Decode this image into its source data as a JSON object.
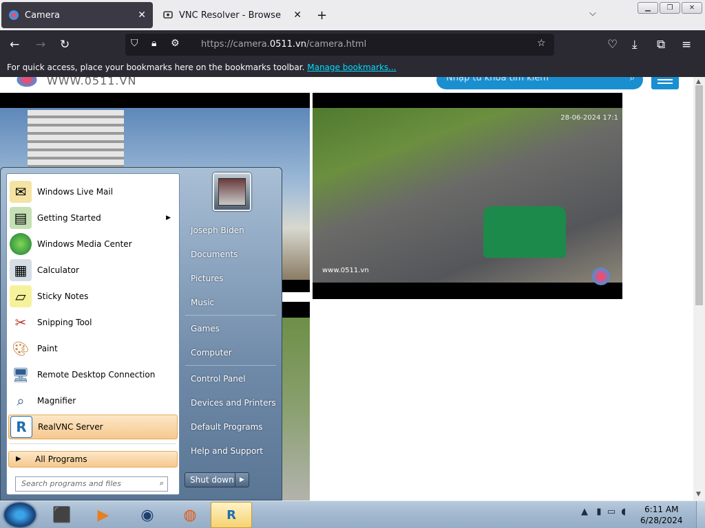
{
  "browser": {
    "tabs": [
      {
        "title": "Camera",
        "active": true
      },
      {
        "title": "VNC Resolver - Browse",
        "active": false
      }
    ],
    "url_prefix": "https://camera.",
    "url_domain": "0511.vn",
    "url_path": "/camera.html",
    "bookmarks_text": "For quick access, place your bookmarks here on the bookmarks toolbar.",
    "bookmarks_link": "Manage bookmarks..."
  },
  "site": {
    "name": "WWW.0511.VN",
    "search_placeholder": "Nhập từ khóa tìm kiếm",
    "cam2_timestamp": "28-06-2024 17:1",
    "cam2_watermark": "www.0511.vn"
  },
  "start_menu": {
    "programs": [
      {
        "label": "Windows Live Mail",
        "icon": "mail-icon"
      },
      {
        "label": "Getting Started",
        "icon": "getting-started-icon",
        "submenu": true
      },
      {
        "label": "Windows Media Center",
        "icon": "media-center-icon"
      },
      {
        "label": "Calculator",
        "icon": "calculator-icon"
      },
      {
        "label": "Sticky Notes",
        "icon": "sticky-notes-icon"
      },
      {
        "label": "Snipping Tool",
        "icon": "scissors-icon"
      },
      {
        "label": "Paint",
        "icon": "paint-palette-icon"
      },
      {
        "label": "Remote Desktop Connection",
        "icon": "remote-desktop-icon"
      },
      {
        "label": "Magnifier",
        "icon": "magnifier-icon"
      },
      {
        "label": "RealVNC Server",
        "icon": "realvnc-icon",
        "highlighted": true
      }
    ],
    "all_programs": "All Programs",
    "search_placeholder": "Search programs and files",
    "right_items": [
      "Joseph Biden",
      "Documents",
      "Pictures",
      "Music",
      "Games",
      "Computer",
      "Control Panel",
      "Devices and Printers",
      "Default Programs",
      "Help and Support"
    ],
    "shutdown": "Shut down"
  },
  "taskbar": {
    "time": "6:11 AM",
    "date": "6/28/2024"
  }
}
